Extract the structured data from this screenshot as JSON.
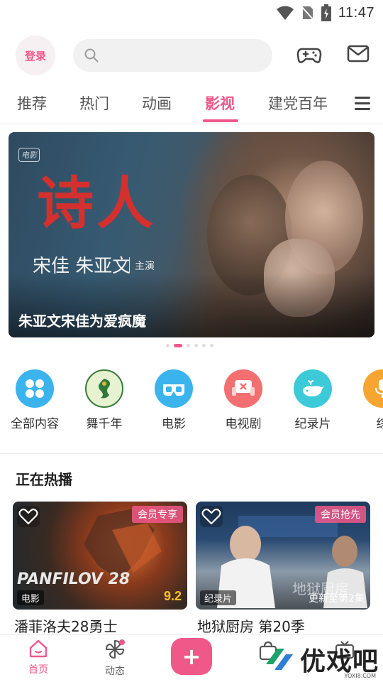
{
  "status_bar": {
    "time": "11:47"
  },
  "header": {
    "login_label": "登录",
    "search_placeholder": ""
  },
  "tabs": [
    {
      "label": "推荐",
      "active": false
    },
    {
      "label": "热门",
      "active": false
    },
    {
      "label": "动画",
      "active": false
    },
    {
      "label": "影视",
      "active": true
    },
    {
      "label": "建党百年",
      "active": false
    }
  ],
  "banner": {
    "badge": "电影",
    "title": "诗人",
    "cast": "宋佳 朱亚文",
    "role": "主演",
    "caption": "朱亚文宋佳为爱疯魔",
    "dot_count": 6,
    "active_dot": 1
  },
  "categories": [
    {
      "label": "全部内容",
      "color": "#3bb4ee",
      "icon": "grid-icon"
    },
    {
      "label": "舞千年",
      "color": "#e6f2d0",
      "icon": "dragon-emblem-icon"
    },
    {
      "label": "电影",
      "color": "#3bb4ee",
      "icon": "3d-glasses-icon"
    },
    {
      "label": "电视剧",
      "color": "#f36f72",
      "icon": "tv-sofa-icon"
    },
    {
      "label": "纪录片",
      "color": "#3ccad8",
      "icon": "whale-icon"
    },
    {
      "label": "综",
      "color": "#f7a531",
      "icon": "microphone-icon"
    }
  ],
  "section": {
    "title": "正在热播",
    "cards": [
      {
        "title": "潘菲洛夫28勇士",
        "badge": "会员专享",
        "tag": "电影",
        "score": "9.2",
        "update": "",
        "poster_text": "PANFILOV 28"
      },
      {
        "title": "地狱厨房 第20季",
        "badge": "会员抢先",
        "tag": "纪录片",
        "score": "",
        "update": "更新至第2集",
        "poster_text": "地狱厨房"
      }
    ]
  },
  "bottom_nav": {
    "items": [
      {
        "label": "首页",
        "icon": "home-icon",
        "active": true
      },
      {
        "label": "动态",
        "icon": "pinwheel-icon",
        "active": false
      }
    ],
    "add_label": "+"
  },
  "watermark": {
    "brand": "优戏吧",
    "url": "YOXI8.COM"
  },
  "colors": {
    "accent": "#f0588a"
  }
}
